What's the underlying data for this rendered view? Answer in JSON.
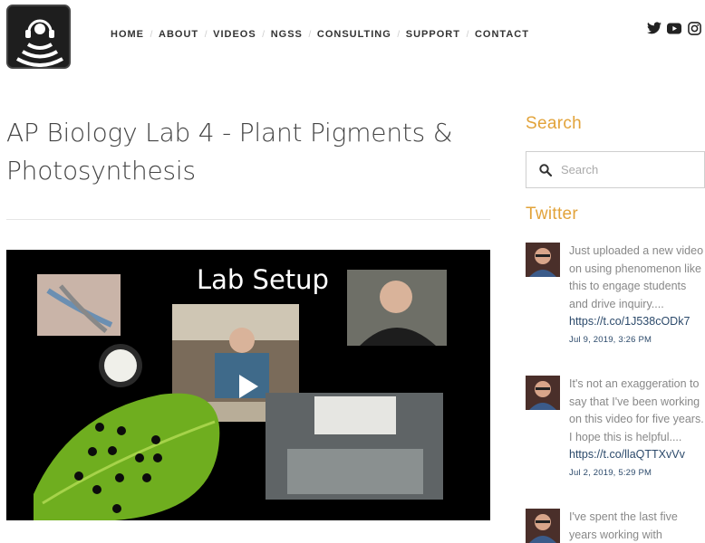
{
  "nav": {
    "items": [
      {
        "label": "HOME"
      },
      {
        "label": "ABOUT"
      },
      {
        "label": "VIDEOS"
      },
      {
        "label": "NGSS"
      },
      {
        "label": "CONSULTING"
      },
      {
        "label": "SUPPORT"
      },
      {
        "label": "CONTACT"
      }
    ]
  },
  "social": [
    "twitter-icon",
    "youtube-icon",
    "instagram-icon"
  ],
  "post": {
    "title": "AP Biology Lab 4 - Plant Pigments & Photosynthesis",
    "video_caption": "Lab Setup"
  },
  "sidebar": {
    "search_heading": "Search",
    "search_placeholder": "Search",
    "twitter_heading": "Twitter",
    "tweets": [
      {
        "text": "Just uploaded a new video on using phenomenon like this to engage students and drive inquiry....",
        "link": "https://t.co/1J538cODk7",
        "date": "Jul 9, 2019, 3:26 PM"
      },
      {
        "text": "It's not an exaggeration to say that I've been working on this video for five years. I hope this is helpful....",
        "link": "https://t.co/llaQTTXvVv",
        "date": "Jul 2, 2019, 5:29 PM"
      },
      {
        "text": "I've spent the last five years working with",
        "link": "",
        "date": ""
      }
    ]
  },
  "colors": {
    "accent": "#e2a33a",
    "link": "#2c4a6b",
    "muted_text": "#888888"
  }
}
